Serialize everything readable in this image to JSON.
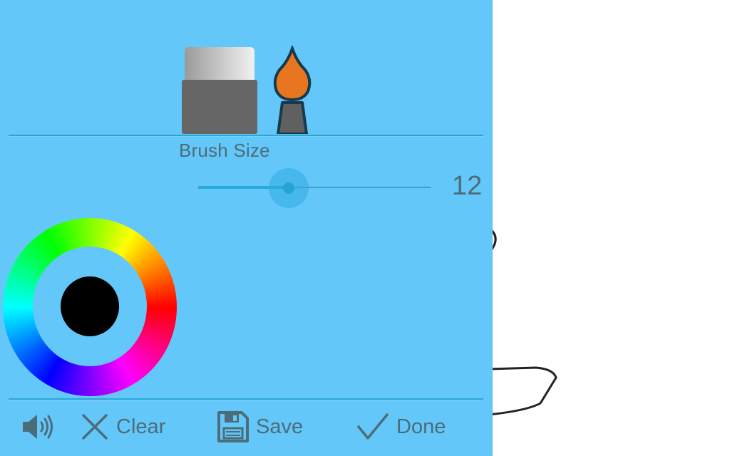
{
  "colors": {
    "panel_bg": "#63c8f9",
    "accent": "#27a9dc",
    "text": "#4d6c7a",
    "selected_color": "#000000",
    "brush_tip": "#e8751f",
    "eraser_body": "#666666"
  },
  "tools": {
    "eraser_icon": "eraser-icon",
    "brush_icon": "paintbrush-icon"
  },
  "brush_size": {
    "label": "Brush Size",
    "value": "12",
    "fraction": 0.39
  },
  "color_picker": {
    "icon": "color-wheel-icon"
  },
  "bottom_bar": {
    "sound_icon": "speaker-icon",
    "clear_label": "Clear",
    "save_label": "Save",
    "done_label": "Done"
  }
}
